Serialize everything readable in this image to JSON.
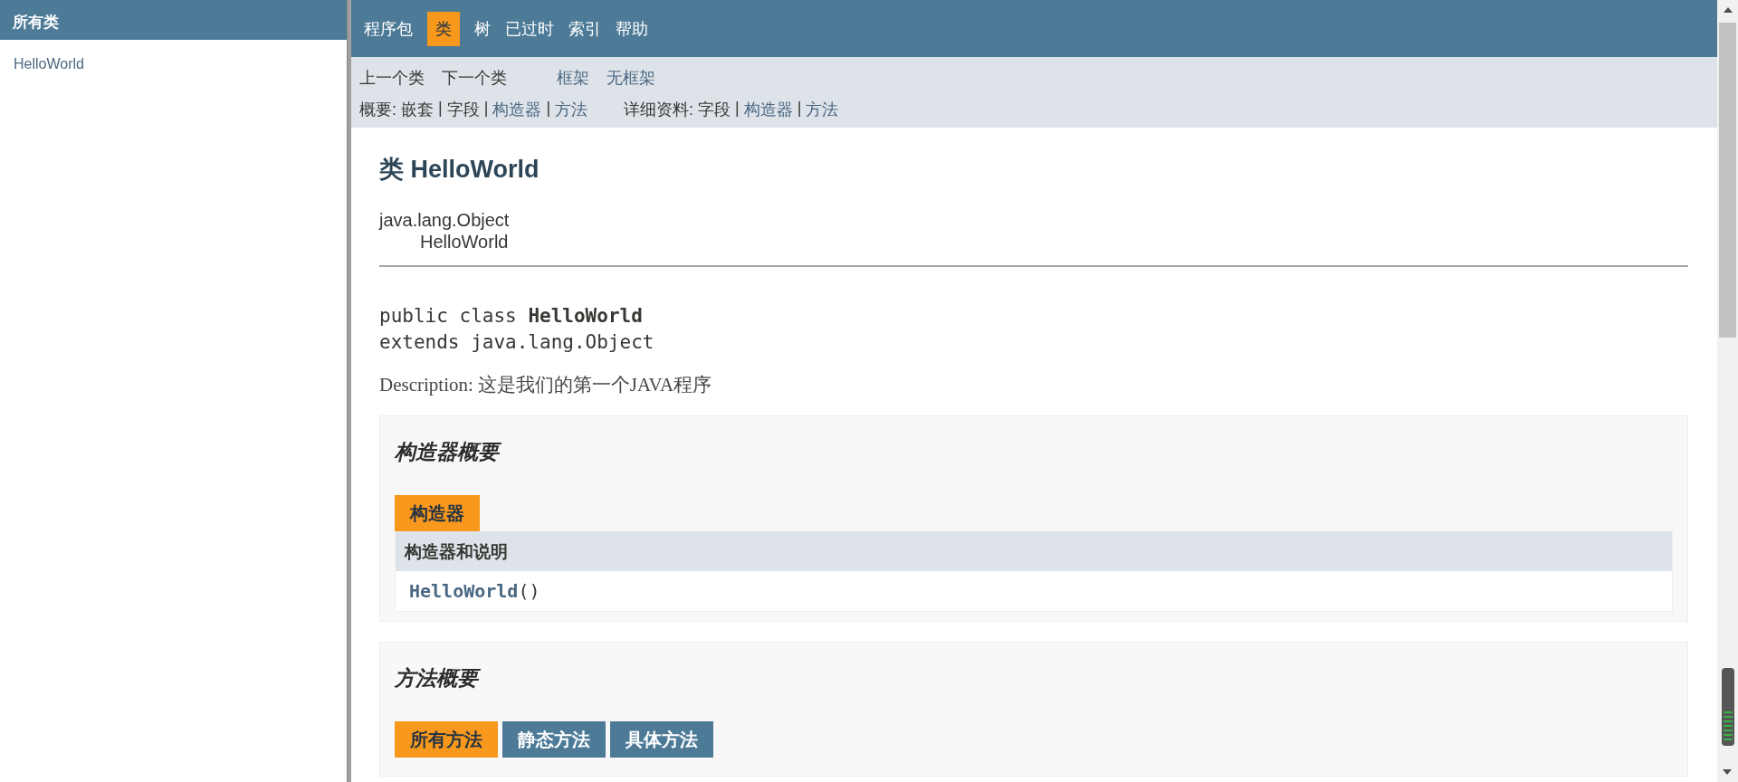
{
  "sidebar": {
    "title": "所有类",
    "items": [
      {
        "label": "HelloWorld"
      }
    ]
  },
  "nav": {
    "items": [
      {
        "label": "程序包",
        "selected": false
      },
      {
        "label": "类",
        "selected": true
      },
      {
        "label": "树",
        "selected": false
      },
      {
        "label": "已过时",
        "selected": false
      },
      {
        "label": "索引",
        "selected": false
      },
      {
        "label": "帮助",
        "selected": false
      }
    ]
  },
  "subnav": {
    "row_1": [
      {
        "label": "上一个类",
        "link": false
      },
      {
        "label": "下一个类",
        "link": false
      },
      {
        "label": "框架",
        "link": true
      },
      {
        "label": "无框架",
        "link": true
      }
    ],
    "summary": {
      "label": "概要:",
      "items": [
        {
          "label": "嵌套",
          "link": false
        },
        {
          "label": "字段",
          "link": false
        },
        {
          "label": "构造器",
          "link": true
        },
        {
          "label": "方法",
          "link": true
        }
      ]
    },
    "detail": {
      "label": "详细资料:",
      "items": [
        {
          "label": "字段",
          "link": false
        },
        {
          "label": "构造器",
          "link": true
        },
        {
          "label": "方法",
          "link": true
        }
      ]
    },
    "separator": "|"
  },
  "content": {
    "title": "类 HelloWorld",
    "hierarchy": [
      "java.lang.Object",
      "HelloWorld"
    ],
    "signature": [
      "public class **HelloWorld**",
      "extends java.lang.Object"
    ],
    "description_label": "Description:",
    "description": "这是我们的第一个JAVA程序",
    "constructor_summary": {
      "heading": "构造器概要",
      "tabs": [
        {
          "label": "构造器",
          "selected": true
        }
      ],
      "column": "构造器和说明",
      "rows": [
        {
          "name": "HelloWorld",
          "params": "()"
        }
      ]
    },
    "method_summary": {
      "heading": "方法概要",
      "tabs": [
        {
          "label": "所有方法",
          "selected": true
        },
        {
          "label": "静态方法",
          "selected": false
        },
        {
          "label": "具体方法",
          "selected": false
        }
      ]
    }
  }
}
